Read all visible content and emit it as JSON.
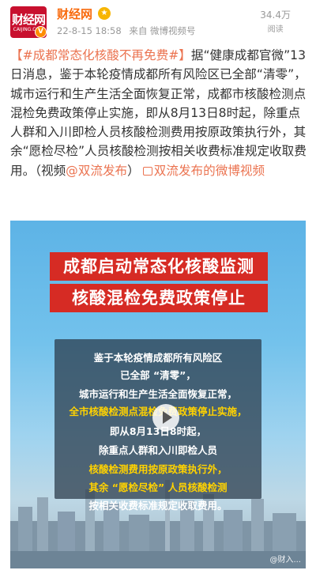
{
  "header": {
    "avatar": {
      "logo_cn": "财经网",
      "logo_en": "CAIJING.COM"
    },
    "username": "财经网",
    "badge_icon": "vip-badge-icon",
    "timestamp": "22-8-15 18:58",
    "source": "来自 微博视频号",
    "read_count": "34.4万",
    "read_label": "阅读"
  },
  "post": {
    "topic": "【#成都常态化核酸不再免费#】",
    "body": "据“健康成都官微”13日消息，鉴于本轮疫情成都所有风险区已全部“清零”，城市运行和生产生活全面恢复正常，成都市核酸检测点混检免费政策停止实施，即从8月13日8时起，除重点人群和入川即检人员核酸检测费用按原政策执行外，其余“愿检尽检”人员核酸检测按相关收费标准规定收取费用。（视频",
    "mention": "@双流发布",
    "close_paren": "）",
    "video_link": "双流发布的微博视频"
  },
  "video": {
    "title_line1": "成都启动常态化核酸监测",
    "title_line2": "核酸混检免费政策停止",
    "lines": [
      "鉴于本轮疫情成都所有风险区",
      "已全部 “清零”，",
      "城市运行和生产生活全面恢复正常，",
      "全市核酸检测点混检免费政策停止实施，",
      "即从8月13日8时起，",
      "除重点人群和入川即检人员",
      "核酸检测费用按原政策执行外，",
      "其余 “愿检尽检” 人员核酸检测",
      "按相关收费标准规定收取费用。"
    ],
    "highlight_lines": [
      3,
      6,
      7
    ],
    "watermark": "@财入..."
  },
  "colors": {
    "username": "#f86a0d",
    "link": "#eb7350",
    "title_bg": "#d62b24",
    "highlight_text": "#ffd200"
  }
}
